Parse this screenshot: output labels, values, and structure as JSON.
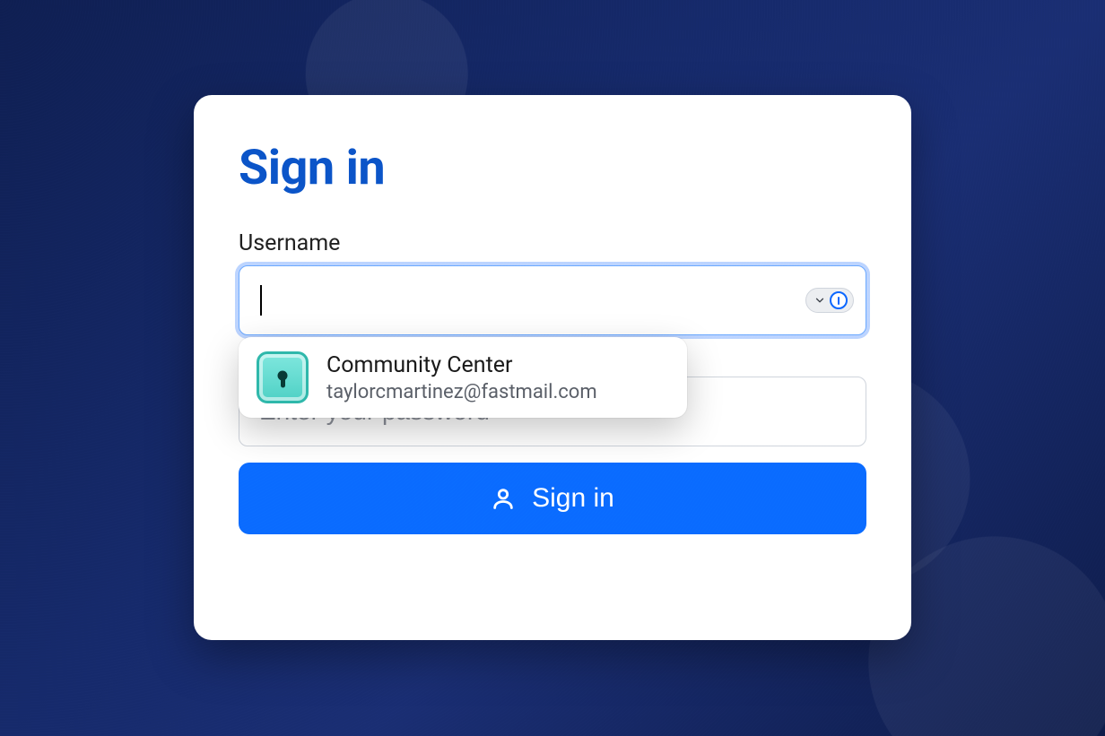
{
  "card": {
    "title": "Sign in",
    "username_label": "Username",
    "username_value": "",
    "username_placeholder": "",
    "password_placeholder": "Enter your password",
    "password_value": "",
    "submit_label": "Sign in"
  },
  "autofill": {
    "site_name": "Community Center",
    "username": "taylorcmartinez@fastmail.com"
  },
  "icons": {
    "chevron": "chevron-down-icon",
    "onepassword": "onepassword-icon",
    "lock": "lock-icon",
    "person": "person-icon"
  },
  "colors": {
    "accent": "#0a6bff",
    "title": "#0b54c8",
    "bg_dark": "#14255e"
  }
}
